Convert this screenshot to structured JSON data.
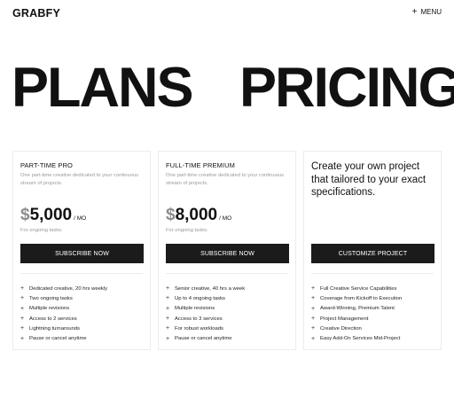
{
  "header": {
    "logo": "GRABFY",
    "menu_icon": "plus-icon",
    "menu_label": "MENU"
  },
  "hero": {
    "word1": "PLANS",
    "word2": "PRICING"
  },
  "plans": [
    {
      "title": "PART-TIME PRO",
      "description": "One part-time creative dedicated to your continuous stream of projects.",
      "currency": "$",
      "amount": "5,000",
      "period": "/ MO",
      "note": "For ongoing tasks.",
      "cta": "SUBSCRIBE NOW",
      "features": [
        "Dedicated creative, 20 hrs weekly",
        "Two ongoing tasks",
        "Multiple revisions",
        "Access to 2 services",
        "Lightning turnarounds",
        "Pause or cancel anytime"
      ]
    },
    {
      "title": "FULL-TIME PREMIUM",
      "description": "One part-time creative dedicated to your continuous stream of projects.",
      "currency": "$",
      "amount": "8,000",
      "period": "/ MO",
      "note": "For ongoing tasks.",
      "cta": "SUBSCRIBE NOW",
      "features": [
        "Senior creative, 40 hrs a week",
        "Up to 4 ongoing tasks",
        "Multiple revisions",
        "Access to 3 services",
        "For robust workloads",
        "Pause or cancel anytime"
      ]
    }
  ],
  "custom": {
    "heading": "Create your own project that tailored to your exact specifications.",
    "cta": "CUSTOMIZE PROJECT",
    "features": [
      "Full Creative Service Capabilities",
      "Coverage from Kickoff to Execution",
      "Award-Winning, Premium Talent",
      "Project Management",
      "Creative Direction",
      "Easy Add-On Services Mid-Project"
    ]
  },
  "bullet_icon": "plus-icon",
  "bullet_glyph": "+"
}
